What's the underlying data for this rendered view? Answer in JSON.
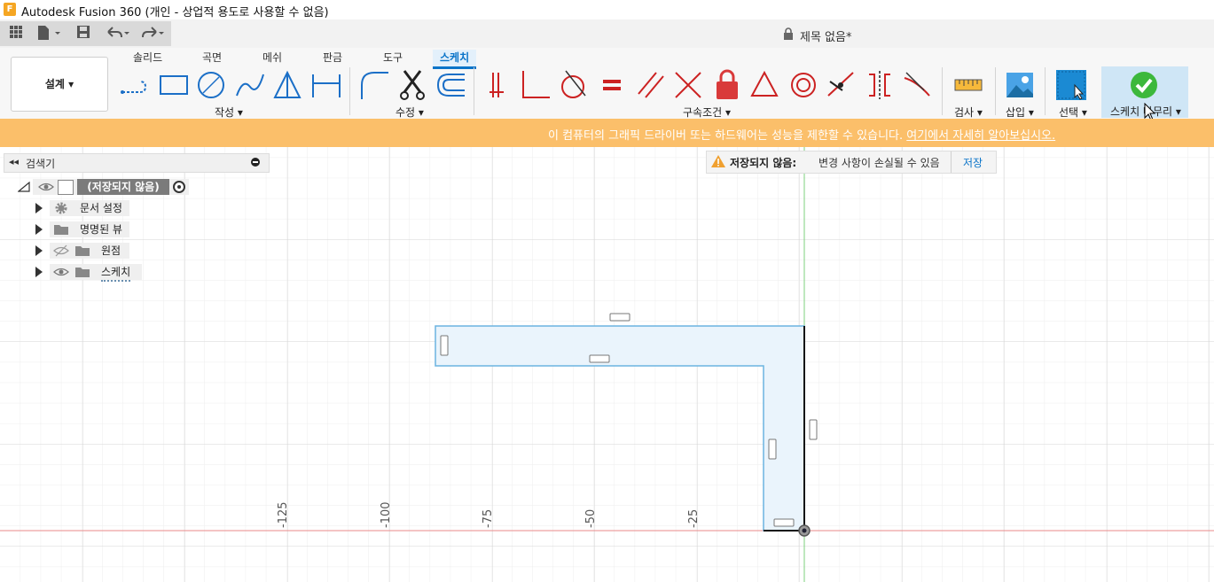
{
  "window": {
    "app_icon_letter": "F",
    "title": "Autodesk Fusion 360 (개인 - 상업적 용도로 사용할 수 없음)"
  },
  "quick_access": {
    "document_title": "제목 없음*",
    "icons": [
      "grid-icon",
      "file-icon",
      "save-icon",
      "undo-icon",
      "redo-icon",
      "lock-icon"
    ]
  },
  "ribbon": {
    "tabs": [
      "솔리드",
      "곡면",
      "메쉬",
      "판금",
      "도구",
      "스케치"
    ],
    "active_tab": "스케치",
    "workspace_label": "설계 ▾",
    "groups": {
      "create": "작성 ▾",
      "modify": "수정 ▾",
      "constraints": "구속조건 ▾",
      "inspect": "검사 ▾",
      "insert": "삽입 ▾",
      "select": "선택 ▾",
      "finish": "스케치 마무리 ▾"
    }
  },
  "banner": {
    "message": "이 컴퓨터의 그래픽 드라이버 또는 하드웨어는 성능을 제한할 수 있습니다.",
    "link": "여기에서 자세히 알아보십시오."
  },
  "browser": {
    "title": "검색기",
    "root": "(저장되지 않음)",
    "nodes": [
      {
        "label": "문서 설정",
        "icon": "gear-icon"
      },
      {
        "label": "명명된 뷰",
        "icon": "folder-icon"
      },
      {
        "label": "원점",
        "icon": "folder-icon"
      },
      {
        "label": "스케치",
        "icon": "folder-icon"
      }
    ]
  },
  "unsaved": {
    "title": "저장되지 않음:",
    "message": "변경 사항이 손실될 수 있음",
    "save": "저장"
  },
  "axis_ticks": [
    "-125",
    "-100",
    "-75",
    "-50",
    "-25"
  ],
  "colors": {
    "accent": "#0a74c9",
    "banner": "#fbbf6a",
    "sketch_fill": "#eaf4fc",
    "sketch_line": "#6bb3e0",
    "x_axis": "#e88a8a",
    "y_axis": "#7cd07c",
    "finish_green": "#3cb83c"
  }
}
